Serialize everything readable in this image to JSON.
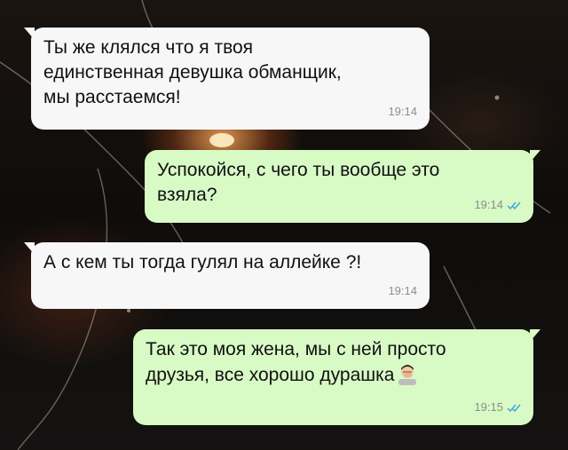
{
  "messages": [
    {
      "direction": "incoming",
      "text": "Ты же клялся что я твоя\nединственная девушка обманщик,\nмы расстаемся!",
      "time": "19:14"
    },
    {
      "direction": "outgoing",
      "text": "Успокойся, с чего ты вообще это\nвзяла?",
      "time": "19:14",
      "status": "read"
    },
    {
      "direction": "incoming",
      "text": "А с кем ты тогда гулял на аллейке ?!",
      "time": "19:14"
    },
    {
      "direction": "outgoing",
      "text": "Так это моя жена, мы с ней просто\nдрузья, все хорошо дурашка",
      "emoji": "man-facepalming-emoji",
      "time": "19:15",
      "status": "read"
    }
  ],
  "colors": {
    "incoming_bubble": "#f7f7f7",
    "outgoing_bubble": "#d8fbc6",
    "read_ticks": "#3fa8e0",
    "timestamp": "#8a8f8a"
  }
}
